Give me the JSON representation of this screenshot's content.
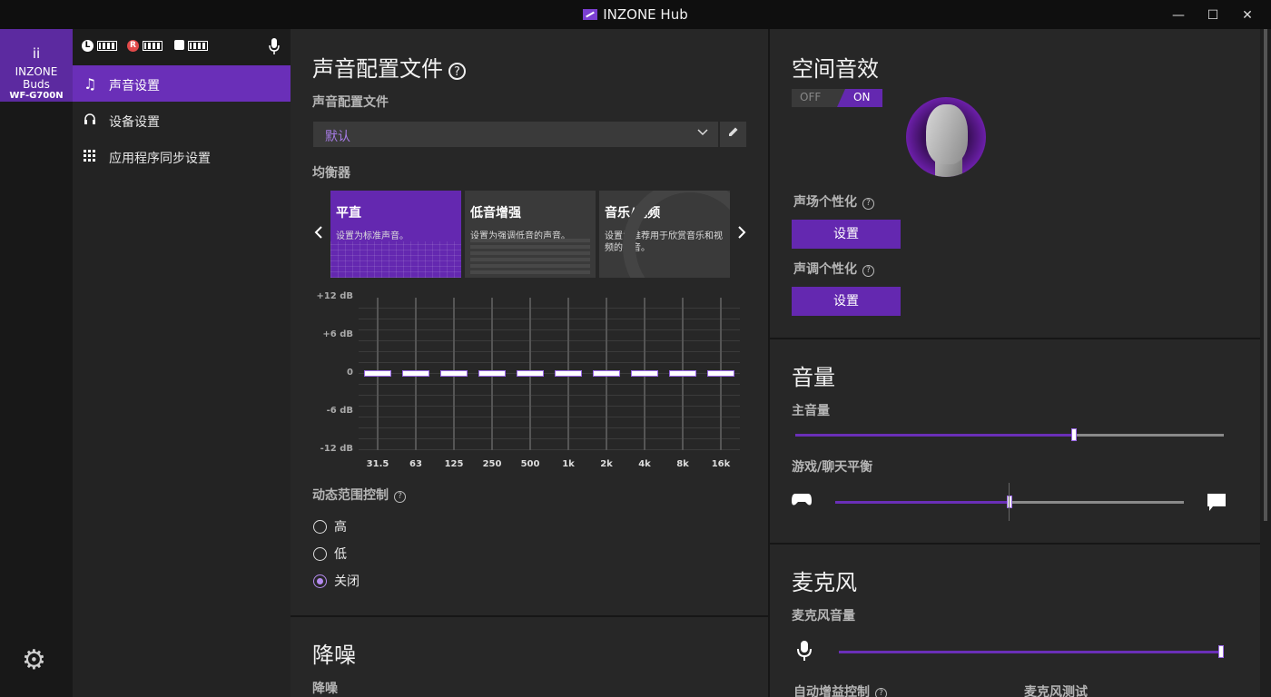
{
  "window": {
    "title": "INZONE Hub",
    "minimize": "—",
    "maximize": "☐",
    "close": "✕"
  },
  "device": {
    "icon": "ⅰⅰ",
    "name": "INZONE Buds",
    "model": "WF-G700N"
  },
  "status": {
    "left": "L",
    "right": "R"
  },
  "nav": {
    "items": [
      {
        "label": "声音设置",
        "icon": "♫"
      },
      {
        "label": "设备设置",
        "icon": "🎧"
      },
      {
        "label": "应用程序同步设置",
        "icon": "▦"
      }
    ],
    "settings_icon": "⚙"
  },
  "sound_profile": {
    "title": "声音配置文件",
    "profile_label": "声音配置文件",
    "profile_value": "默认",
    "eq_label": "均衡器",
    "presets": [
      {
        "title": "平直",
        "desc": "设置为标准声音。"
      },
      {
        "title": "低音增强",
        "desc": "设置为强调低音的声音。"
      },
      {
        "title": "音乐/视频",
        "desc": "设置为推荐用于欣赏音乐和视频的声音。"
      }
    ],
    "db_labels": [
      "+12 dB",
      "+6 dB",
      "0",
      "-6 dB",
      "-12 dB"
    ],
    "bands": [
      "31.5",
      "63",
      "125",
      "250",
      "500",
      "1k",
      "2k",
      "4k",
      "8k",
      "16k"
    ],
    "band_gains_db": [
      0,
      0,
      0,
      0,
      0,
      0,
      0,
      0,
      0,
      0
    ],
    "drc_label": "动态范围控制",
    "drc_options": [
      "高",
      "低",
      "关闭"
    ],
    "drc_selected": "关闭"
  },
  "noise": {
    "title": "降噪",
    "label": "降噪"
  },
  "spatial": {
    "title": "空间音效",
    "toggle_off": "OFF",
    "toggle_on": "ON",
    "toggle_state": "ON",
    "field_label": "声场个性化",
    "field_button": "设置",
    "tone_label": "声调个性化",
    "tone_button": "设置"
  },
  "volume": {
    "title": "音量",
    "master_label": "主音量",
    "master_value": 0.65,
    "balance_label": "游戏/聊天平衡",
    "balance_value": 0.5
  },
  "mic": {
    "title": "麦克风",
    "volume_label": "麦克风音量",
    "volume_value": 1.0,
    "agc_label": "自动增益控制",
    "test_label": "麦克风测试"
  },
  "colors": {
    "accent": "#6428b0",
    "accent_light": "#a77ce6"
  }
}
